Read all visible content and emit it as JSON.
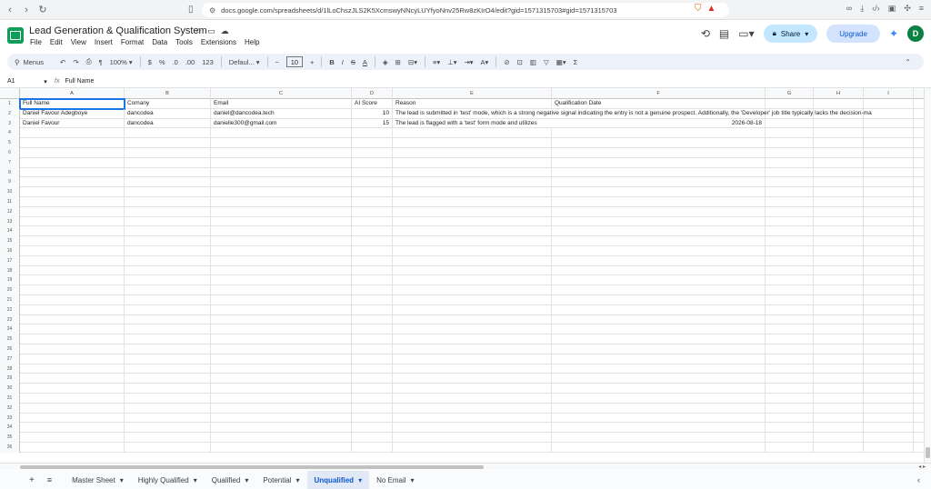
{
  "browser": {
    "url": "docs.google.com/spreadsheets/d/1lLoChszJLS2K5XcmswyNNcyLUYfyoNnv25Rw8zKIrO4/edit?gid=1571315703#gid=1571315703"
  },
  "doc": {
    "title": "Lead Generation & Qualification System",
    "menu": [
      "File",
      "Edit",
      "View",
      "Insert",
      "Format",
      "Data",
      "Tools",
      "Extensions",
      "Help"
    ],
    "share_label": "Share",
    "upgrade_label": "Upgrade",
    "avatar_initial": "D"
  },
  "toolbar": {
    "menus_label": "Menus",
    "zoom": "100%",
    "currency": "$",
    "percent": "%",
    "dec_decrease": ".0",
    "dec_increase": ".00",
    "number_format": "123",
    "font": "Defaul...",
    "font_size": "10",
    "bold": "B",
    "italic": "I",
    "strike": "S",
    "text_color": "A"
  },
  "formula": {
    "cell_ref": "A1",
    "content": "Full Name"
  },
  "grid": {
    "columns": [
      "A",
      "B",
      "C",
      "D",
      "E",
      "F",
      "G",
      "H",
      "I"
    ],
    "rows": [
      [
        "Full Name",
        "Comany",
        "Email",
        "AI Score",
        "Reason",
        "Qualification Date"
      ],
      [
        "Daniel Favour Adegboye",
        "dancodea",
        "daniel@dancodea.tech",
        "10",
        "The lead is submitted in 'test' mode, which is a strong negative signal indicating the entry is not a genuine prospect. Additionally, the 'Developer' job title typically lacks the decision-ma",
        ""
      ],
      [
        "Daniel Favour",
        "dancodea",
        "danielle300@gmail.com",
        "15",
        "The lead is flagged with a 'test' form mode and utilizes",
        "2026-08-18"
      ]
    ],
    "row_count": 36
  },
  "tabs": [
    {
      "label": "Master Sheet",
      "active": false
    },
    {
      "label": "Highly Qualified",
      "active": false
    },
    {
      "label": "Qualified",
      "active": false
    },
    {
      "label": "Potential",
      "active": false
    },
    {
      "label": "Unqualified",
      "active": true
    },
    {
      "label": "No Email",
      "active": false
    }
  ]
}
